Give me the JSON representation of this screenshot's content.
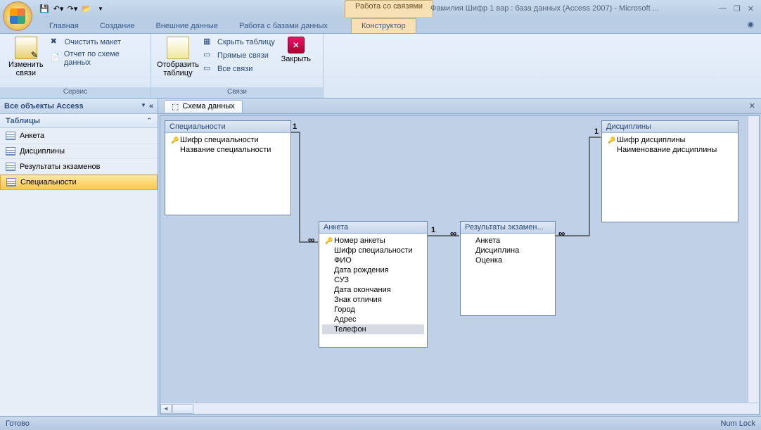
{
  "titlebar": {
    "context_tab": "Работа со связями",
    "title": "Фамилия Шифр 1 вар : база данных (Access 2007) - Microsoft ..."
  },
  "tabs": {
    "home": "Главная",
    "create": "Создание",
    "external": "Внешние данные",
    "dbtools": "Работа с базами данных",
    "designer": "Конструктор"
  },
  "ribbon": {
    "group_service": "Сервис",
    "group_links": "Связи",
    "btn_edit_links": "Изменить связи",
    "btn_clear_layout": "Очистить макет",
    "btn_schema_report": "Отчет по схеме данных",
    "btn_show_table": "Отобразить таблицу",
    "btn_hide_table": "Скрыть таблицу",
    "btn_direct_links": "Прямые связи",
    "btn_all_links": "Все связи",
    "btn_close": "Закрыть"
  },
  "nav": {
    "header": "Все объекты Access",
    "group": "Таблицы",
    "items": [
      "Анкета",
      "Дисциплины",
      "Результаты экзаменов",
      "Специальности"
    ],
    "selected_index": 3
  },
  "doc": {
    "tab": "Схема данных"
  },
  "tables": {
    "spec": {
      "title": "Специальности",
      "fields": [
        {
          "key": true,
          "name": "Шифр специальности"
        },
        {
          "key": false,
          "name": "Название специальности"
        }
      ]
    },
    "anketa": {
      "title": "Анкета",
      "fields": [
        {
          "key": true,
          "name": "Номер анкеты"
        },
        {
          "key": false,
          "name": "Шифр специальности"
        },
        {
          "key": false,
          "name": "ФИО"
        },
        {
          "key": false,
          "name": "Дата рождения"
        },
        {
          "key": false,
          "name": "СУЗ"
        },
        {
          "key": false,
          "name": "Дата окончания"
        },
        {
          "key": false,
          "name": "Знак отличия"
        },
        {
          "key": false,
          "name": "Город"
        },
        {
          "key": false,
          "name": "Адрес"
        },
        {
          "key": false,
          "name": "Телефон"
        }
      ],
      "selected_field_index": 9
    },
    "results": {
      "title": "Результаты экзамен...",
      "fields": [
        {
          "key": false,
          "name": "Анкета"
        },
        {
          "key": false,
          "name": "Дисциплина"
        },
        {
          "key": false,
          "name": "Оценка"
        }
      ]
    },
    "disc": {
      "title": "Дисциплины",
      "fields": [
        {
          "key": true,
          "name": "Шифр дисциплины"
        },
        {
          "key": false,
          "name": "Наименование дисциплины"
        }
      ]
    }
  },
  "relations": {
    "one": "1",
    "many": "∞"
  },
  "status": {
    "left": "Готово",
    "right": "Num Lock"
  }
}
